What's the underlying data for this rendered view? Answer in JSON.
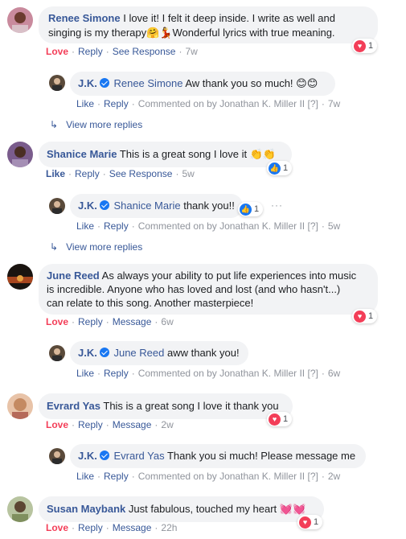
{
  "comments": [
    {
      "author": "Renee Simone",
      "text": "I love it! I felt it deep inside. I write as well and",
      "text2": "singing is my therapy🤗💃Wonderful lyrics with true meaning.",
      "action1": "Love",
      "action2": "Reply",
      "action3": "See Response",
      "time": "7w",
      "reaction_count": "1",
      "reply": {
        "author": "J.K.",
        "tag": "Renee Simone",
        "text": "Aw thank you so much! 😊😊",
        "a1": "Like",
        "a2": "Reply",
        "meta": "Commented on by Jonathan K. Miller II",
        "q": "[?]",
        "time": "7w"
      },
      "more": "View more replies"
    },
    {
      "author": "Shanice Marie",
      "text": "This is a great song I love it 👏👏",
      "action1": "Like",
      "action2": "Reply",
      "action3": "See Response",
      "time": "5w",
      "reaction_count": "1",
      "reply": {
        "author": "J.K.",
        "tag": "Shanice Marie",
        "text": "thank you!!",
        "a1": "Like",
        "a2": "Reply",
        "meta": "Commented on by Jonathan K. Miller II",
        "q": "[?]",
        "time": "5w",
        "reaction_count": "1",
        "dots": "···"
      },
      "more": "View more replies"
    },
    {
      "author": "June Reed",
      "text": "As always your ability to put life experiences into music",
      "text2": "is incredible. Anyone who has loved and lost (and who hasn't...)",
      "text3": "can relate to this song. Another masterpiece!",
      "action1": "Love",
      "action2": "Reply",
      "action3": "Message",
      "time": "6w",
      "reaction_count": "1",
      "reply": {
        "author": "J.K.",
        "tag": "June Reed",
        "text": "aww thank you!",
        "a1": "Like",
        "a2": "Reply",
        "meta": "Commented on by Jonathan K. Miller II",
        "q": "[?]",
        "time": "6w"
      }
    },
    {
      "author": "Evrard Yas",
      "text": "This is a great song I love it thank you",
      "action1": "Love",
      "action2": "Reply",
      "action3": "Message",
      "time": "2w",
      "reaction_count": "1",
      "reply": {
        "author": "J.K.",
        "tag": "Evrard Yas",
        "text": "Thank you si much! Please message me",
        "a1": "Like",
        "a2": "Reply",
        "meta": "Commented on by Jonathan K. Miller II",
        "q": "[?]",
        "time": "2w"
      }
    },
    {
      "author": "Susan Maybank",
      "text": "Just fabulous, touched my heart 💓💓",
      "action1": "Love",
      "action2": "Reply",
      "action3": "Message",
      "time": "22h",
      "reaction_count": "1"
    }
  ],
  "icons": {
    "heart": "heart-reaction-icon",
    "like": "like-reaction-icon",
    "verified": "verified-badge-icon",
    "reply_arrow": "reply-arrow-icon"
  },
  "colors": {
    "link": "#385898",
    "love": "#f33e58",
    "like": "#1877f2",
    "bubble": "#f2f3f5",
    "meta": "#90949c"
  }
}
